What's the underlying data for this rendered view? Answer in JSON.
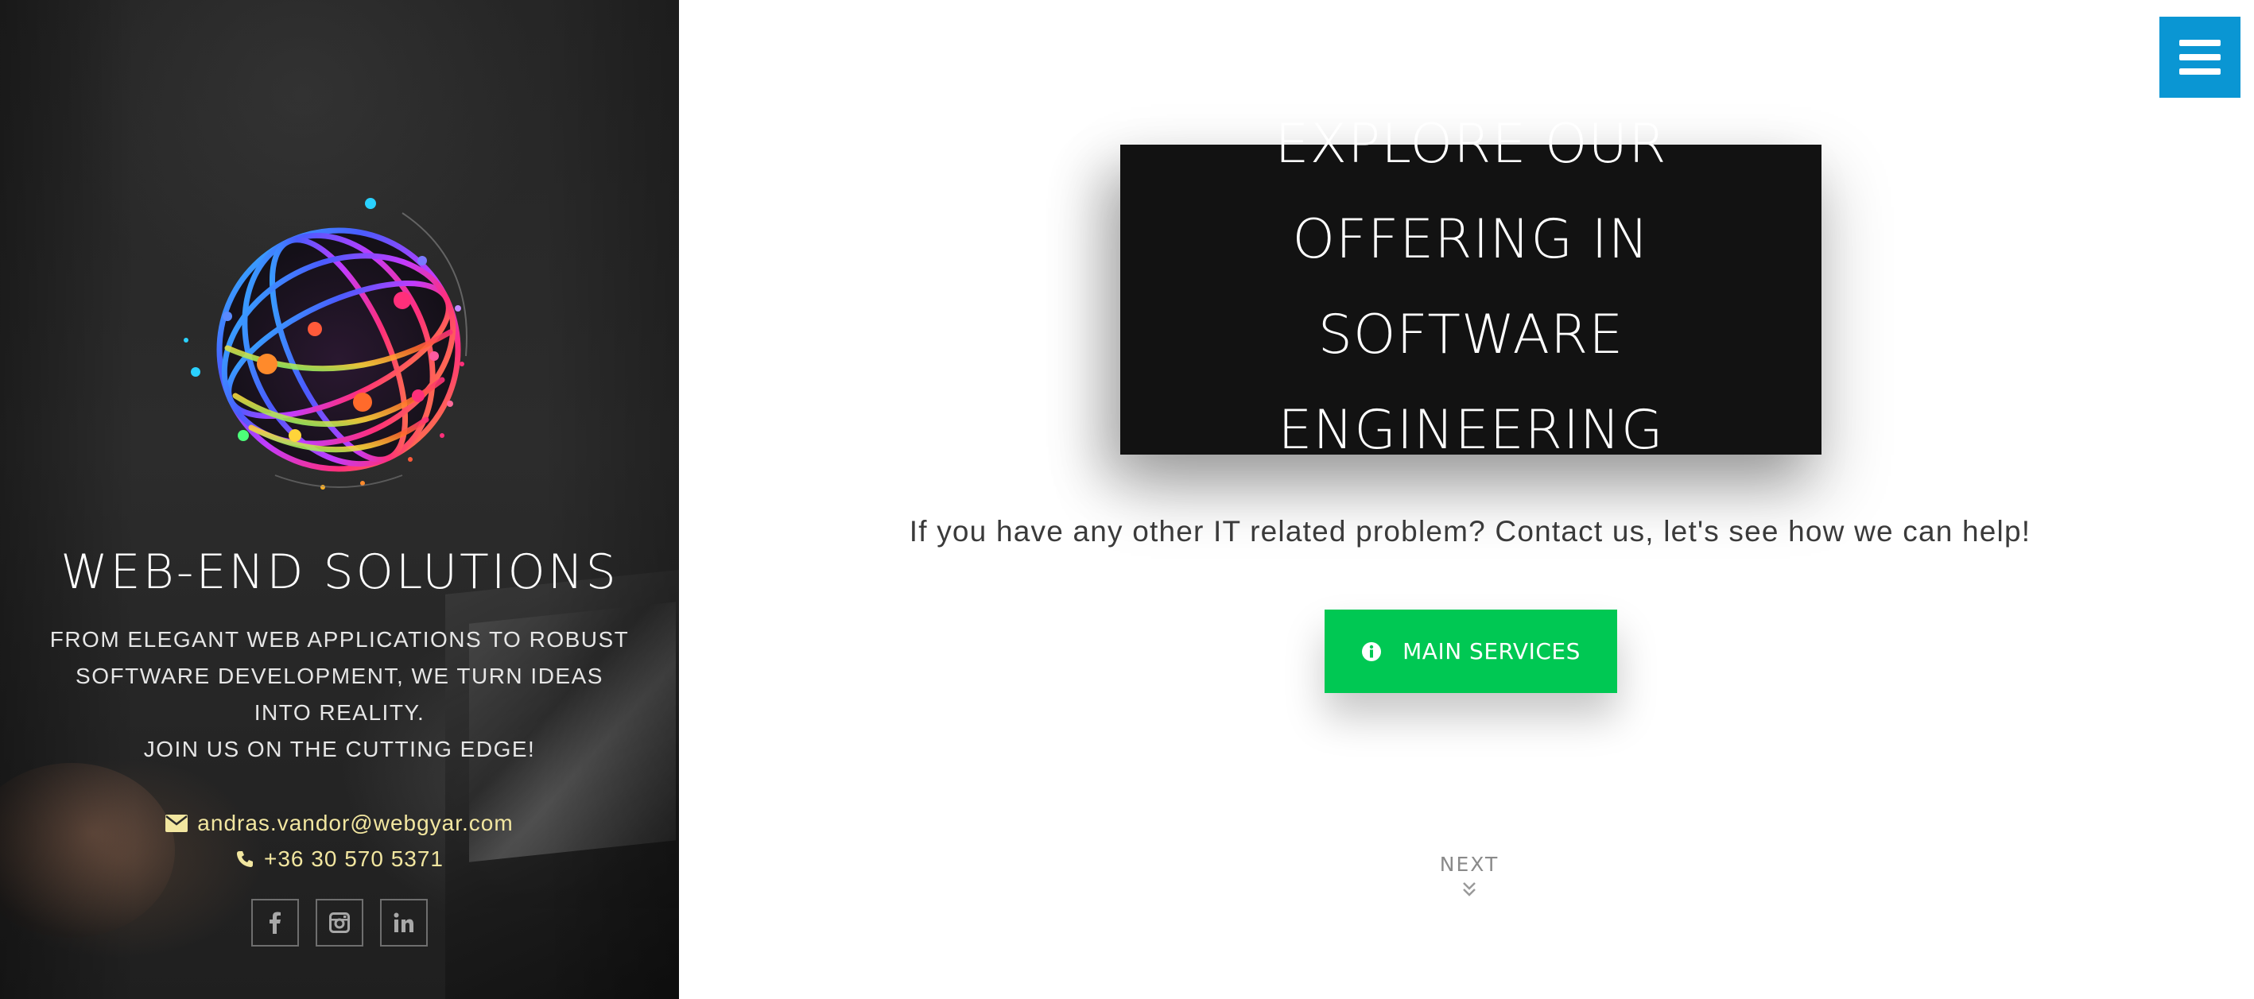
{
  "sidebar": {
    "brand_title": "WEB-END SOLUTIONS",
    "tagline_lines": [
      "FROM ELEGANT WEB APPLICATIONS TO ROBUST SOFTWARE DEVELOPMENT, WE TURN IDEAS INTO REALITY.",
      "JOIN US ON THE CUTTING EDGE!"
    ],
    "email": "andras.vandor@webgyar.com",
    "phone": "+36 30 570 5371",
    "socials": [
      {
        "name": "facebook",
        "icon": "facebook-icon"
      },
      {
        "name": "instagram",
        "icon": "instagram-icon"
      },
      {
        "name": "linkedin",
        "icon": "linkedin-icon"
      }
    ],
    "contact_color": "#f2e6a0"
  },
  "main": {
    "menu_icon": "hamburger-menu-icon",
    "hero_title": "EXPLORE OUR OFFERING IN SOFTWARE ENGINEERING",
    "subtext": "If you have any other IT related problem? Contact us, let's see how we can help!",
    "cta_label": "MAIN SERVICES",
    "cta_icon": "info-circle-icon",
    "next_label": "NEXT",
    "next_icon": "double-chevron-down-icon"
  },
  "colors": {
    "menu_button": "#0a96d3",
    "cta_button": "#00c853",
    "hero_box": "#121212",
    "sidebar_bg": "#262626"
  }
}
